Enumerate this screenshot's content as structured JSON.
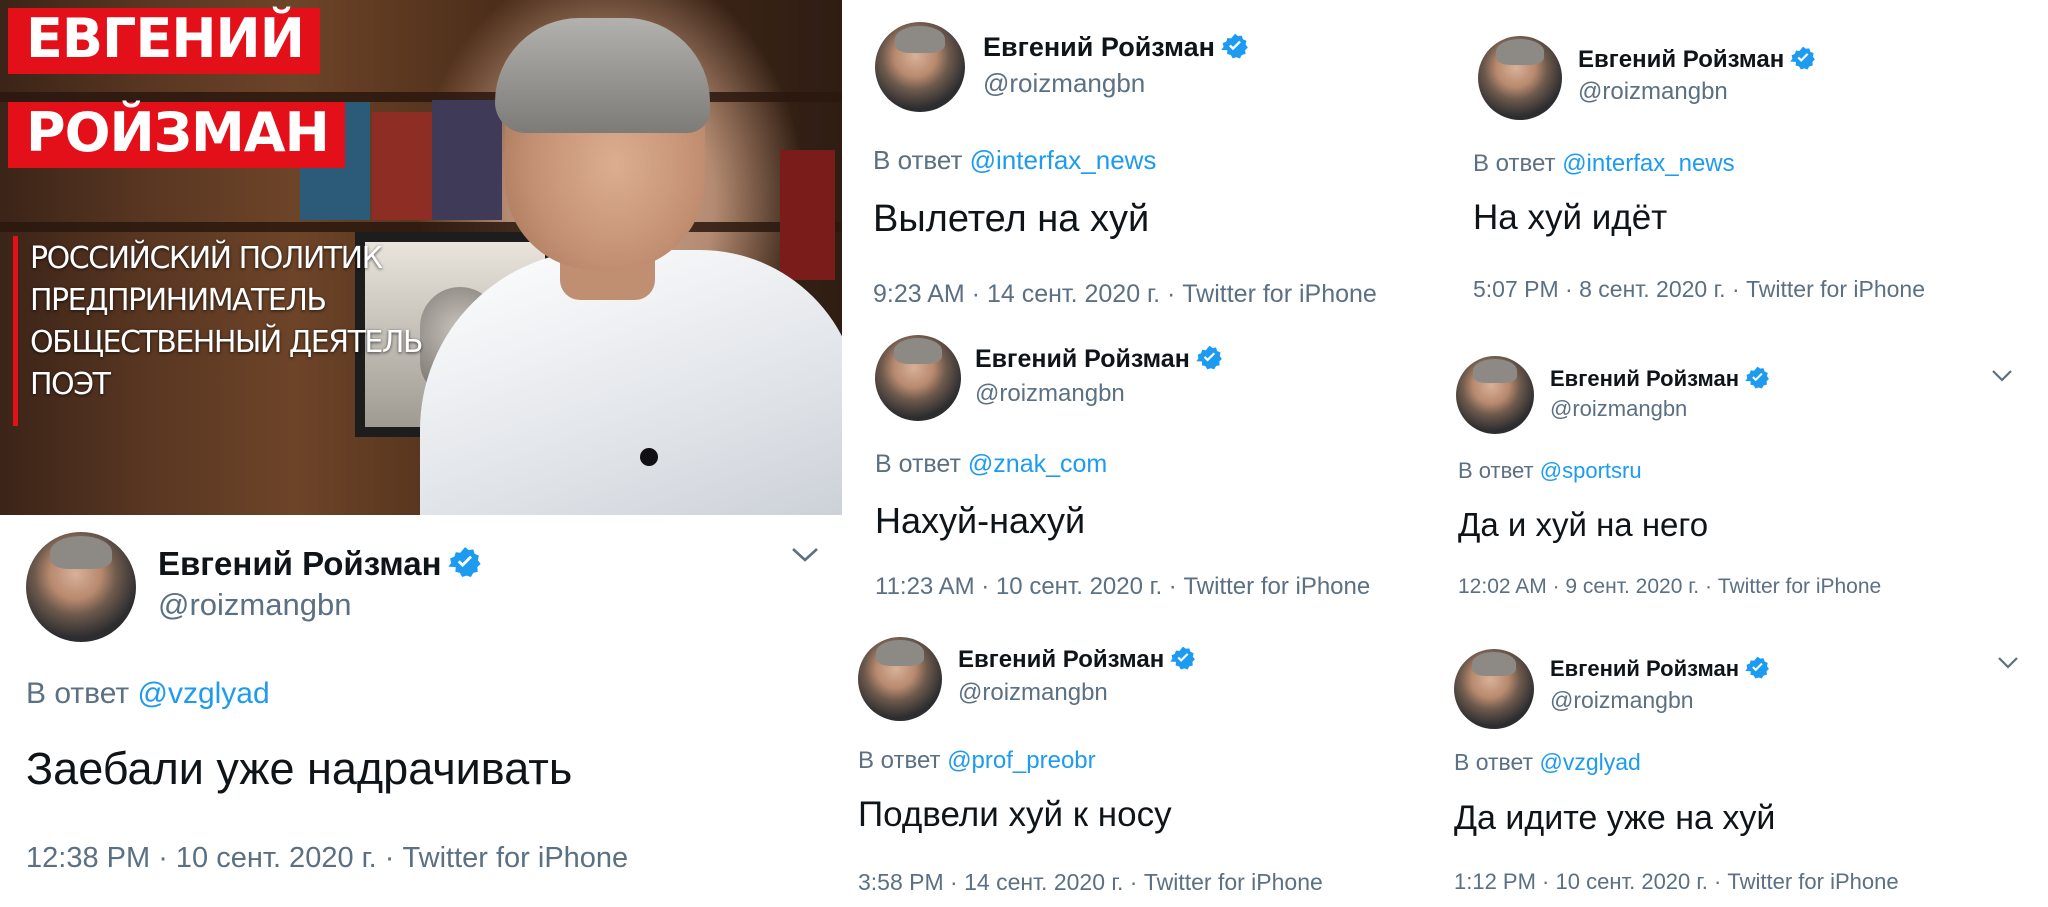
{
  "banner": {
    "name_line1": "ЕВГЕНИЙ",
    "name_line2": "РОЙЗМАН",
    "subtitle": [
      "РОССИЙСКИЙ ПОЛИТИК",
      "ПРЕДПРИНИМАТЕЛЬ",
      "ОБЩЕСТВЕННЫЙ ДЕЯТЕЛЬ",
      "ПОЭТ"
    ]
  },
  "colors": {
    "accent": "#1d9bf0",
    "secondary_text": "#5b7083",
    "tag_red": "#e3101a"
  },
  "icons": {
    "verified": "verified-badge-icon",
    "more": "chevron-down-icon"
  },
  "tweets": [
    {
      "name": "Евгений Ройзман",
      "handle": "@roizmangbn",
      "reply_prefix": "В ответ",
      "reply_to": "@vzglyad",
      "text": "Заебали уже надрачивать",
      "time": "12:38 PM",
      "date": "10 сент. 2020 г.",
      "source": "Twitter for iPhone"
    },
    {
      "name": "Евгений Ройзман",
      "handle": "@roizmangbn",
      "reply_prefix": "В ответ",
      "reply_to": "@interfax_news",
      "text": "Вылетел на хуй",
      "time": "9:23 AM",
      "date": "14 сент. 2020 г.",
      "source": "Twitter for iPhone"
    },
    {
      "name": "Евгений Ройзман",
      "handle": "@roizmangbn",
      "reply_prefix": "В ответ",
      "reply_to": "@interfax_news",
      "text": "На хуй идёт",
      "time": "5:07 PM",
      "date": "8 сент. 2020 г.",
      "source": "Twitter for iPhone"
    },
    {
      "name": "Евгений Ройзман",
      "handle": "@roizmangbn",
      "reply_prefix": "В ответ",
      "reply_to": "@znak_com",
      "text": "Нахуй-нахуй",
      "time": "11:23 AM",
      "date": "10 сент. 2020 г.",
      "source": "Twitter for iPhone"
    },
    {
      "name": "Евгений Ройзман",
      "handle": "@roizmangbn",
      "reply_prefix": "В ответ",
      "reply_to": "@sportsru",
      "text": "Да и хуй на него",
      "time": "12:02 AM",
      "date": "9 сент. 2020 г.",
      "source": "Twitter for iPhone"
    },
    {
      "name": "Евгений Ройзман",
      "handle": "@roizmangbn",
      "reply_prefix": "В ответ",
      "reply_to": "@prof_preobr",
      "text": "Подвели хуй к носу",
      "time": "3:58 PM",
      "date": "14 сент. 2020 г.",
      "source": "Twitter for iPhone"
    },
    {
      "name": "Евгений Ройзман",
      "handle": "@roizmangbn",
      "reply_prefix": "В ответ",
      "reply_to": "@vzglyad",
      "text": "Да идите уже на хуй",
      "time": "1:12 PM",
      "date": "10 сент. 2020 г.",
      "source": "Twitter for iPhone"
    }
  ]
}
